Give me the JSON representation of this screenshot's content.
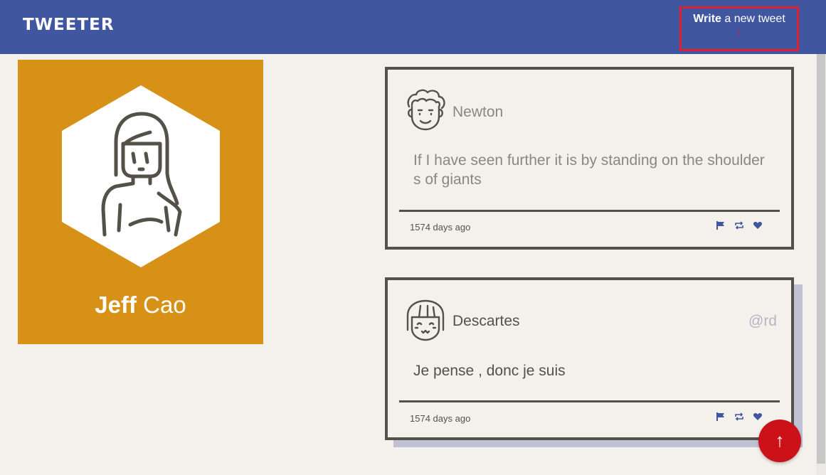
{
  "header": {
    "brand": "TWEETER",
    "compose_bold": "Write",
    "compose_rest": " a new tweet",
    "compose_arrow": "↓"
  },
  "profile": {
    "first_name": "Jeff",
    "last_name": " Cao"
  },
  "tweets": [
    {
      "author": "Newton",
      "handle": "",
      "text": "If I have seen further it is by standing on the shoulders of giants",
      "time": "1574 days ago"
    },
    {
      "author": "Descartes",
      "handle": "@rd",
      "text": "Je pense , donc je suis",
      "time": "1574 days ago"
    }
  ],
  "icons": {
    "flag": "flag-icon",
    "retweet": "retweet-icon",
    "like": "heart-icon",
    "back_to_top": "arrow-up-icon"
  },
  "fab_glyph": "↑",
  "colors": {
    "nav": "#4056a1",
    "accent_red": "#e0202d",
    "profile_bg": "#d79116",
    "card_border": "#545149",
    "page_bg": "#f4f1ec"
  }
}
